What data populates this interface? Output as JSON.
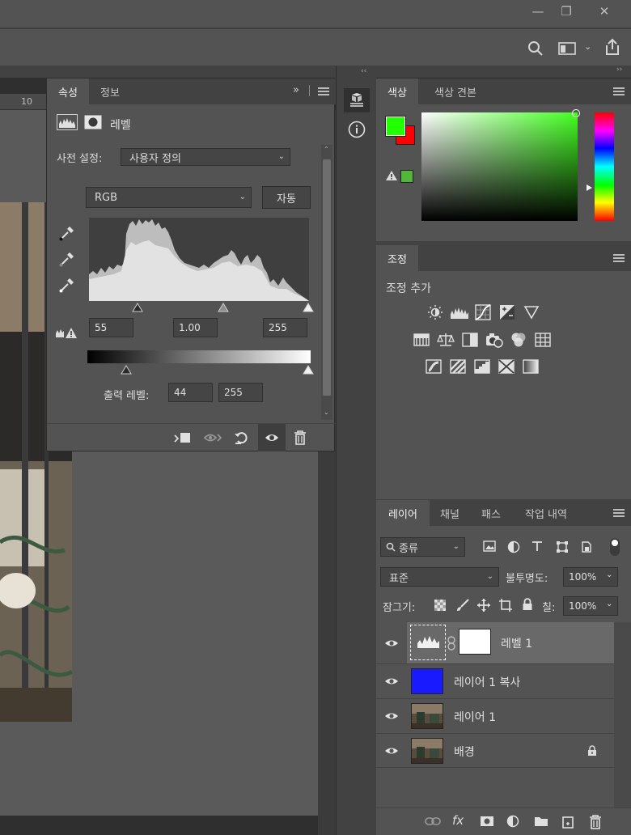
{
  "window": {
    "minimize": "—",
    "restore": "❐",
    "close": "✕"
  },
  "ruler": {
    "tick": "10"
  },
  "colors": {
    "foreground": "#22ff00",
    "background": "#ff0000",
    "gamut_swatch": "#52b63a",
    "hue_top": "#44ff22"
  },
  "properties": {
    "tabs": [
      "속성",
      "정보"
    ],
    "expand": "»",
    "title": "레벨",
    "preset_label": "사전 설정:",
    "preset_value": "사용자 정의",
    "channel": "RGB",
    "auto": "자동",
    "input_black": "55",
    "input_gamma": "1.00",
    "input_white": "255",
    "output_label": "출력 레벨:",
    "output_black": "44",
    "output_white": "255"
  },
  "color_panel": {
    "tabs": [
      "색상",
      "색상 견본"
    ]
  },
  "adjustments": {
    "tab": "조정",
    "heading": "조정 추가"
  },
  "layers": {
    "tabs": [
      "레이어",
      "채널",
      "패스",
      "작업 내역"
    ],
    "filter_kind": "종류",
    "blend_mode": "표준",
    "opacity_label": "불투명도:",
    "opacity_value": "100%",
    "lock_label": "잠그기:",
    "fill_label": "칠:",
    "fill_value": "100%",
    "items": [
      {
        "name": "레벨 1",
        "thumb_color": "#dcdcdc",
        "selected": true
      },
      {
        "name": "레이어 1 복사",
        "thumb_color": "#1a1aff",
        "selected": false
      },
      {
        "name": "레이어 1",
        "thumb_color": "#4a3c30",
        "selected": false
      },
      {
        "name": "배경",
        "thumb_color": "#4a3c30",
        "selected": false
      }
    ]
  }
}
